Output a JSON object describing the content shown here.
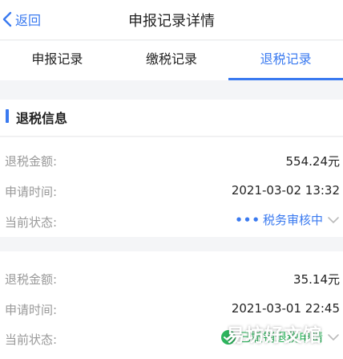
{
  "nav": {
    "back_label": "返回",
    "title": "申报记录详情"
  },
  "tabs": [
    {
      "label": "申报记录",
      "active": false
    },
    {
      "label": "缴税记录",
      "active": false
    },
    {
      "label": "退税记录",
      "active": true
    }
  ],
  "section": {
    "title": "退税信息"
  },
  "records": [
    {
      "amount_label": "退税金额:",
      "amount": "554.24元",
      "time_label": "申请时间:",
      "time": "2021-03-02 13:32",
      "status_label": "当前状态:",
      "status": "税务审核中"
    },
    {
      "amount_label": "退税金额:",
      "amount": "35.14元",
      "time_label": "申请时间:",
      "time": "2021-03-01 22:45",
      "status_label": "当前状态:",
      "status": "已撤销退税申请"
    }
  ],
  "watermark": "易坊好文馆",
  "colors": {
    "accent": "#3a7af0",
    "success": "#2db55d",
    "label": "#999999"
  }
}
